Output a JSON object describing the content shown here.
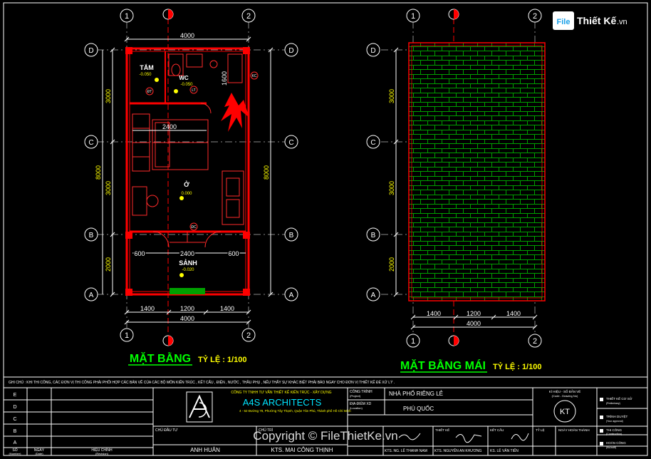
{
  "colors": {
    "background": "#000000",
    "frame": "#ffffff",
    "grid_circle": "#ffffff",
    "dimension": "#ffffff",
    "dimension_text": "#ffffff",
    "wall": "#ff0000",
    "wall_dark": "#cc0000",
    "furniture": "#ff2a2a",
    "room_label": "#ffffff",
    "level_text": "#ffff00",
    "roof_tile": "#00a000",
    "title_text": "#00ff00",
    "scale_text": "#ffff00",
    "vertical_dim": "#ffff00",
    "note_text": "#ffffff",
    "a4s_text": "#00e5ff",
    "company_text": "#ffff00"
  },
  "logo": {
    "brand_left": "File",
    "brand_right": "Thiết Kế",
    "brand_suffix": ".vn"
  },
  "plan": {
    "grid_top": [
      "1",
      "2"
    ],
    "grid_bottom": [
      "1",
      "2"
    ],
    "grid_rows": [
      "D",
      "C",
      "B",
      "A"
    ],
    "dim_top": "4000",
    "dim_bottom_total": "4000",
    "dim_bottom_parts": [
      "1400",
      "1200",
      "1400"
    ],
    "dim_left": [
      "3000",
      "3000",
      "2000"
    ],
    "dim_left_total": "8000",
    "dim_right_total": "8000",
    "dim_inner_2400_top": "2400",
    "dim_inner_1600": "1600",
    "dim_inner_bottom": [
      "600",
      "2400",
      "600"
    ],
    "rooms": {
      "tam": "TẮM",
      "wc": "WC",
      "o": "Ở",
      "sanh": "SẢNH"
    },
    "levels": {
      "tam": "-0.050",
      "wc": "-0.050",
      "o": "0.000",
      "sanh": "-0.020"
    },
    "tags": [
      "ĐT",
      "LT",
      "ĐC",
      "KC"
    ],
    "title": "MẶT BẰNG",
    "scale": "TỶ LỆ : 1/100"
  },
  "roof": {
    "grid_top": [
      "1",
      "2"
    ],
    "grid_bottom": [
      "1",
      "2"
    ],
    "grid_rows": [
      "D",
      "C",
      "B",
      "A"
    ],
    "dim_left": [
      "3000",
      "3000",
      "2000"
    ],
    "dim_bottom_parts": [
      "1400",
      "1200",
      "1400"
    ],
    "dim_bottom_total": "4000",
    "title": "MẶT BẰNG MÁI",
    "scale": "TỶ LỆ : 1/100"
  },
  "title_block": {
    "note": "GHI CHÚ : KHI THI CÔNG, CÁC ĐƠN VỊ THI CÔNG PHẢI PHỐI HỢP CÁC BẢN VẼ CỦA CÁC BỘ MÔN KIẾN TRÚC , KẾT CẤU , ĐIỆN , NƯỚC , THẦU PHỤ , NẾU THẤY SỰ KHÁC BIỆT PHẢI BÁO NGAY CHO ĐƠN VỊ THIẾT KẾ ĐỂ XỬ LÝ .",
    "revision_rows": [
      "E",
      "D",
      "C",
      "B",
      "A"
    ],
    "revision_headers": {
      "no": "SỐ",
      "no_en": "(Number)",
      "date": "NGÀY",
      "date_en": "(Date)",
      "desc": "HIỆU CHỈNH",
      "desc_en": "(Revision)"
    },
    "company_line": "CÔNG TY TNHH TƯ VẤN THIẾT KẾ KIẾN TRÚC - XÂY DỰNG",
    "company_name": "A4S ARCHITECTS",
    "company_address": "4 - 62 Đường 78, Phường Tây Thạnh, Quận Tân Phú, Thành phố Hồ Chí Minh",
    "owner_label": "CHỦ ĐẦU TƯ",
    "owner_name": "ANH HUÂN",
    "chief_label": "CHỦ TRÌ",
    "chief_name": "KTS. MAI CÔNG THỊNH",
    "project_label": "CÔNG TRÌNH",
    "project_label_en": "(Project)",
    "project_name": "NHÀ PHỐ RIÊNG LẺ",
    "location_label": "ĐỊA ĐIỂM XD",
    "location_label_en": "(Location)",
    "location_name": "PHÚ QUỐC",
    "drawing_code_label": "KÍ HIỆU - SỐ BẢN VẼ",
    "drawing_code_label_en": "(Code - Drawing No)",
    "drawing_code": "KT",
    "role_labels": [
      "THIẾT KẾ",
      "KẾT CẤU",
      "TỶ LỆ",
      "NGÀY HOÀN THÀNH"
    ],
    "designers": [
      "KTS. NG. LÊ THANH NAM",
      "KTS. NGUYỄN AN KHƯƠNG",
      "KS. LÊ VĂN TIẾN"
    ],
    "phases": [
      "THIẾT KẾ CƠ SỞ",
      "TRÌNH DUYỆT",
      "THI CÔNG",
      "HOÀN CÔNG"
    ],
    "phases_en": [
      "(Preliminary)",
      "(Your approval)",
      "(Construction)",
      "(As-built)"
    ],
    "copyright": "Copyright © FileThietKe.vn"
  }
}
